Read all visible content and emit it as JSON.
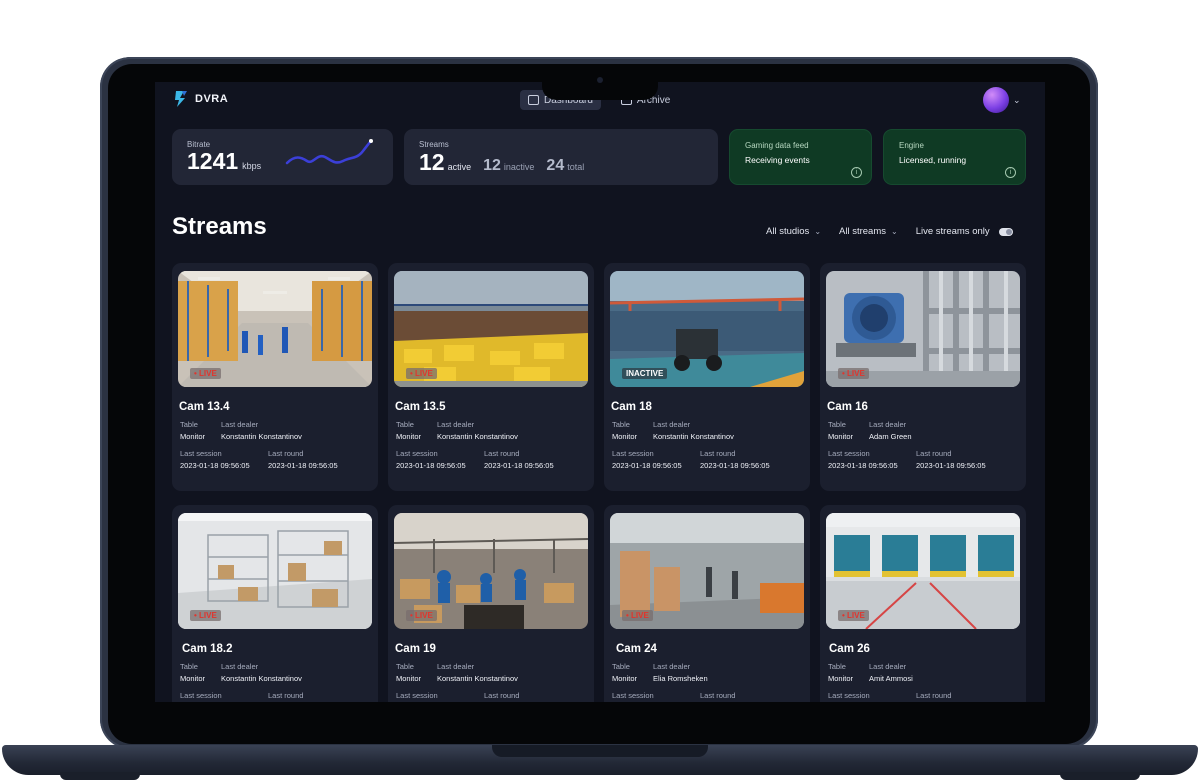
{
  "app": {
    "name": "DVRA"
  },
  "nav": [
    {
      "label": "Dashboard",
      "active": true
    },
    {
      "label": "Archive",
      "active": false
    }
  ],
  "stats": {
    "bitrate": {
      "label": "Bitrate",
      "value": "1241",
      "unit": "kbps"
    },
    "streams": {
      "label": "Streams",
      "active": "12",
      "active_word": "active",
      "inactive": "12",
      "inactive_word": "inactive",
      "total": "24",
      "total_word": "total"
    },
    "feed": {
      "label": "Gaming data feed",
      "status": "Receiving events",
      "color": "#0f3a24"
    },
    "engine": {
      "label": "Engine",
      "status": "Licensed, running",
      "color": "#0f3a24"
    }
  },
  "main": {
    "title": "Streams",
    "filters": {
      "studios": "All studios",
      "streams": "All streams",
      "live_only": "Live streams only"
    }
  },
  "labels": {
    "table": "Table",
    "last_dealer": "Last dealer",
    "last_session": "Last session",
    "last_round": "Last round"
  },
  "cards": [
    {
      "cam": "Cam 13.4",
      "status": "LIVE",
      "table": "Monitor",
      "dealer": "Konstantin Konstantinov",
      "session": "2023-01-18 09:56:05",
      "round": "2023-01-18 09:56:05"
    },
    {
      "cam": "Cam 13.5",
      "status": "LIVE",
      "table": "Monitor",
      "dealer": "Konstantin Konstantinov",
      "session": "2023-01-18 09:56:05",
      "round": "2023-01-18 09:56:05"
    },
    {
      "cam": "Cam 18",
      "status": "INACTIVE",
      "table": "Monitor",
      "dealer": "Konstantin Konstantinov",
      "session": "2023-01-18 09:56:05",
      "round": "2023-01-18 09:56:05"
    },
    {
      "cam": "Cam 16",
      "status": "LIVE",
      "table": "Monitor",
      "dealer": "Adam Green",
      "session": "2023-01-18 09:56:05",
      "round": "2023-01-18 09:56:05"
    },
    {
      "cam": "Cam 18.2",
      "status": "LIVE",
      "table": "Monitor",
      "dealer": "Konstantin Konstantinov"
    },
    {
      "cam": "Cam 19",
      "status": "LIVE",
      "table": "Monitor",
      "dealer": "Konstantin Konstantinov"
    },
    {
      "cam": "Cam 24",
      "status": "LIVE",
      "table": "Monitor",
      "dealer": "Elia Romsheken"
    },
    {
      "cam": "Cam 26",
      "status": "LIVE",
      "table": "Monitor",
      "dealer": "Amit Ammosi"
    }
  ],
  "colors": {
    "background": "#10131f",
    "card": "#1b1f2e",
    "accent_line": "#3f3ed6",
    "live": "#e0352e"
  }
}
